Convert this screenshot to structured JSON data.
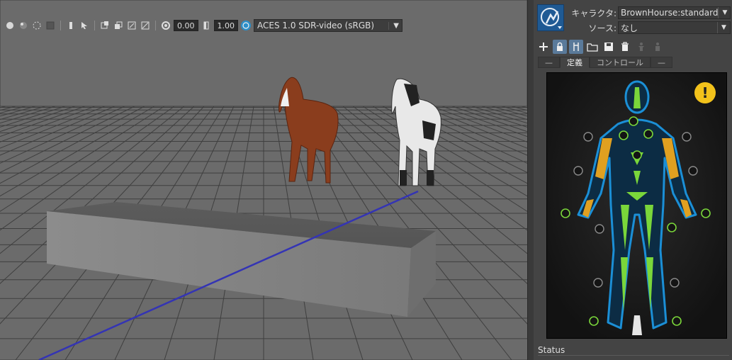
{
  "viewport": {
    "exposure_value": "0.00",
    "gamma_value": "1.00",
    "color_space": "ACES 1.0 SDR-video (sRGB)"
  },
  "panel": {
    "character_label": "キャラクタ:",
    "character_value": "BrownHourse:standard",
    "source_label": "ソース:",
    "source_value": "なし",
    "tabs": [
      {
        "label": "—"
      },
      {
        "label": "定義"
      },
      {
        "label": "コントロール"
      },
      {
        "label": "—"
      }
    ],
    "warning_glyph": "!",
    "status_label": "Status"
  },
  "colors": {
    "viewport_bg": "#6b6b6b",
    "grid_line": "#3f3f3f",
    "axis_blue": "#3434b4",
    "effector_green": "#7ad63a",
    "effector_orange": "#e0a020",
    "figure_glow": "#1b8fd6",
    "warning_yellow": "#f2c21b"
  },
  "icons": [
    "sphere-icon",
    "shaded-sphere-icon",
    "wireframe-sphere-icon",
    "texture-icon",
    "pin-icon",
    "select-icon",
    "isolate-icon",
    "layer-icon",
    "layer-stack-icon",
    "image-plane-icon",
    "exposure-icon",
    "gamma-icon",
    "color-management-icon",
    "add-icon",
    "lock-icon",
    "skeleton-icon",
    "folder-icon",
    "save-icon",
    "delete-icon",
    "character-icon",
    "character-alt-icon",
    "warning-icon"
  ]
}
